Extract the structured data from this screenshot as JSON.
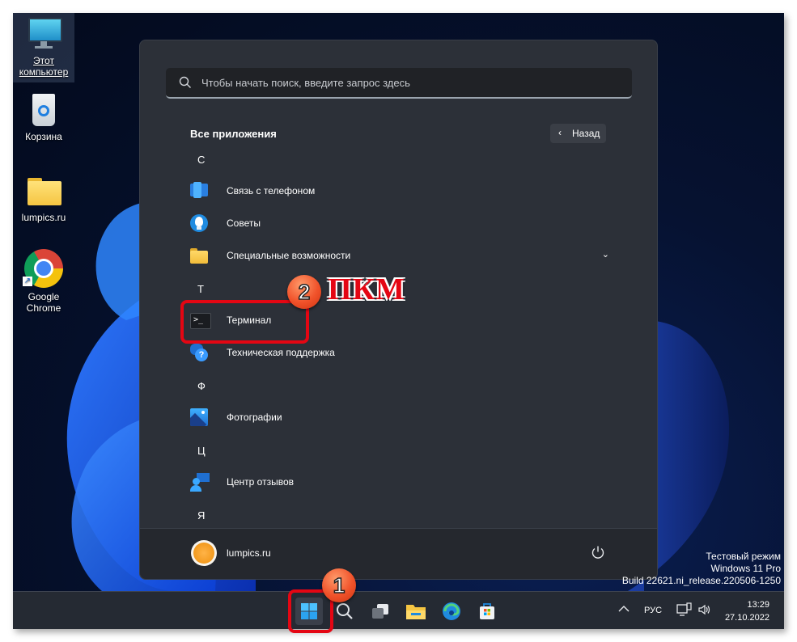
{
  "desktop": {
    "icons": [
      {
        "label": "Этот компьютер",
        "icon": "monitor-icon",
        "selected": true
      },
      {
        "label": "Корзина",
        "icon": "recycle-bin-icon"
      },
      {
        "label": "lumpics.ru",
        "icon": "folder-icon"
      },
      {
        "label": "Google Chrome",
        "icon": "chrome-icon"
      }
    ],
    "watermark": [
      "Тестовый режим",
      "Windows 11 Pro",
      "Build 22621.ni_release.220506-1250"
    ]
  },
  "start_menu": {
    "search_placeholder": "Чтобы начать поиск, введите запрос здесь",
    "section_title": "Все приложения",
    "back_label": "Назад",
    "groups": [
      {
        "letter": "С",
        "apps": [
          {
            "name": "Связь с телефоном",
            "icon": "phone-link-icon"
          },
          {
            "name": "Советы",
            "icon": "tips-bulb-icon"
          },
          {
            "name": "Специальные возможности",
            "icon": "folder-icon",
            "expandable": true
          }
        ]
      },
      {
        "letter": "Т",
        "apps": [
          {
            "name": "Терминал",
            "icon": "terminal-icon"
          },
          {
            "name": "Техническая поддержка",
            "icon": "get-help-icon"
          }
        ]
      },
      {
        "letter": "Ф",
        "apps": [
          {
            "name": "Фотографии",
            "icon": "photos-icon"
          }
        ]
      },
      {
        "letter": "Ц",
        "apps": [
          {
            "name": "Центр отзывов",
            "icon": "feedback-hub-icon"
          }
        ]
      },
      {
        "letter": "Я",
        "apps": []
      }
    ],
    "user_name": "lumpics.ru"
  },
  "taskbar": {
    "apps": [
      "start-icon",
      "search-icon",
      "task-view-icon",
      "file-explorer-icon",
      "edge-icon",
      "store-icon"
    ],
    "language": "РУС",
    "time": "13:29",
    "date": "27.10.2022"
  },
  "annotations": {
    "step1": "1",
    "step2": "2",
    "step2_label": "ПКМ",
    "accent": "#e40613"
  }
}
